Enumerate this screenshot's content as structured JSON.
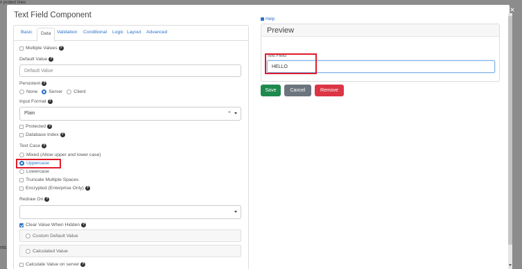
{
  "backdrop": {
    "top_text": "n protect lines",
    "left_text": "nts"
  },
  "modal": {
    "title": "Text Field Component",
    "close_label": "×"
  },
  "tabs": [
    {
      "label": "Basic"
    },
    {
      "label": "Data"
    },
    {
      "label": "Validation"
    },
    {
      "label": "Conditional"
    },
    {
      "label": "Logic"
    },
    {
      "label": "Layout"
    },
    {
      "label": "Advanced"
    }
  ],
  "data_tab": {
    "multiple_values": "Multiple Values",
    "default_value_label": "Default Value",
    "default_value_placeholder": "Default Value",
    "persistent_label": "Persistent",
    "persistent_options": [
      "None",
      "Server",
      "Client"
    ],
    "input_format_label": "Input Format",
    "input_format_value": "Plain",
    "input_format_clear": "×",
    "protected": "Protected",
    "database_index": "Database Index",
    "text_case_label": "Text Case",
    "text_case_options": [
      "Mixed (Allow upper and lower case)",
      "Uppercase",
      "Lowercase"
    ],
    "truncate": "Truncate Multiple Spaces",
    "encrypted": "Encrypted (Enterprise Only)",
    "redraw_on_label": "Redraw On",
    "clear_value": "Clear Value When Hidden",
    "custom_default": "Custom Default Value",
    "calculated_value": "Calculated Value",
    "calculate_on_server": "Calculate Value on server",
    "info_glyph": "?"
  },
  "help": {
    "label": "Help"
  },
  "preview": {
    "title": "Preview",
    "field_label": "Text Field",
    "field_value": "HELLO"
  },
  "buttons": {
    "save": "Save",
    "cancel": "Cancel",
    "remove": "Remove"
  },
  "colors": {
    "save": "#1e8a4e",
    "cancel": "#6c757d",
    "remove": "#dc3545",
    "accent": "#2a73c8",
    "highlight": "#e01b2b"
  }
}
